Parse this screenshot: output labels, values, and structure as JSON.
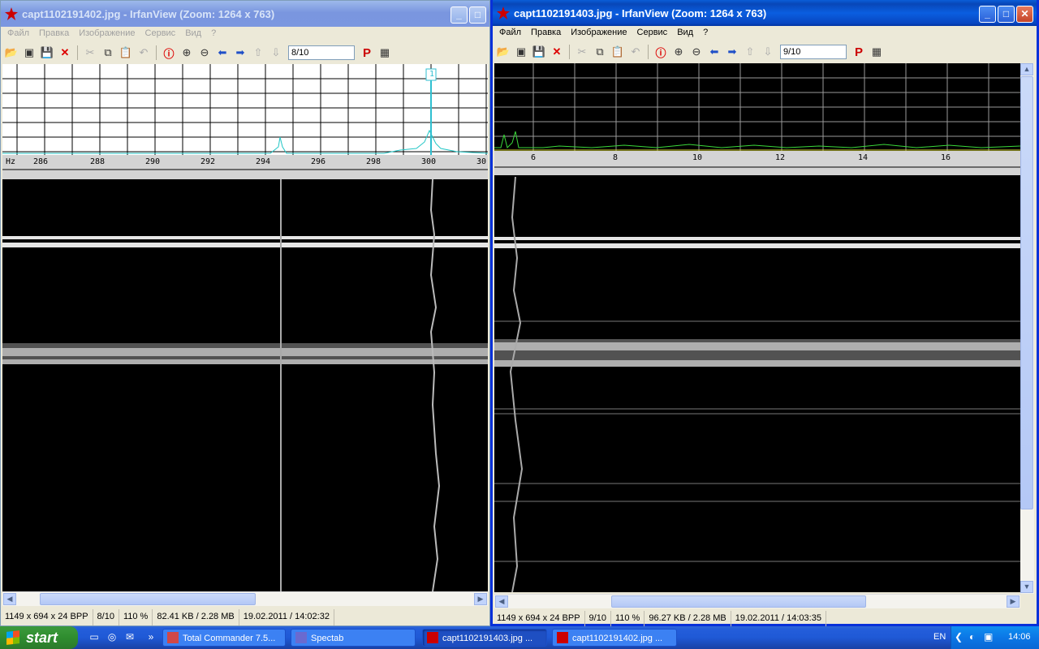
{
  "left_window": {
    "title": "capt1102191402.jpg - IrfanView (Zoom: 1264 x 763)",
    "menu": [
      "Файл",
      "Правка",
      "Изображение",
      "Сервис",
      "Вид",
      "?"
    ],
    "page_field": "8/10",
    "axis_unit": "Hz",
    "axis_ticks": [
      "286",
      "288",
      "290",
      "292",
      "294",
      "296",
      "298",
      "300",
      "30"
    ],
    "marker_label": "1",
    "status": [
      "1149 x 694 x 24 BPP",
      "8/10",
      "110 %",
      "82.41 KB / 2.28 MB",
      "19.02.2011 / 14:02:32"
    ]
  },
  "right_window": {
    "title": "capt1102191403.jpg - IrfanView (Zoom: 1264 x 763)",
    "menu": [
      "Файл",
      "Правка",
      "Изображение",
      "Сервис",
      "Вид",
      "?"
    ],
    "page_field": "9/10",
    "axis_ticks": [
      "6",
      "8",
      "10",
      "12",
      "14",
      "16"
    ],
    "status": [
      "1149 x 694 x 24 BPP",
      "9/10",
      "110 %",
      "96.27 KB / 2.28 MB",
      "19.02.2011 / 14:03:35"
    ]
  },
  "toolbar_icons": [
    "open-icon",
    "slideshow-icon",
    "save-icon",
    "delete-icon",
    "cut-icon",
    "copy-icon",
    "paste-icon",
    "undo-icon",
    "info-icon",
    "zoom-in-icon",
    "zoom-out-icon",
    "prev-icon",
    "next-icon",
    "first-icon",
    "last-icon",
    "print-icon",
    "about-icon"
  ],
  "taskbar": {
    "start_label": "start",
    "tasks": [
      {
        "label": "Total Commander 7.5...",
        "pressed": false
      },
      {
        "label": "Spectab",
        "pressed": false
      },
      {
        "label": "capt1102191403.jpg ...",
        "pressed": true
      },
      {
        "label": "capt1102191402.jpg ...",
        "pressed": false
      }
    ],
    "language": "EN",
    "clock": "14:06"
  },
  "colors": {
    "active_title": "#0a5ee0",
    "inactive_title": "#7a96df",
    "spectrum_line": "#22c6c6",
    "marker": "#2fbfd0",
    "waterfall_bg": "#000000"
  }
}
